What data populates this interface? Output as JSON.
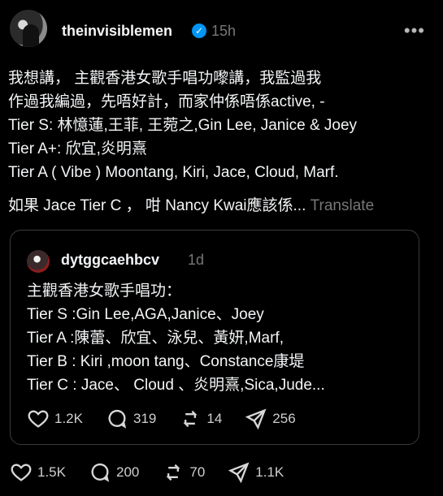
{
  "author": {
    "username": "theinvisiblemen",
    "time": "15h",
    "verified_mark": "✓",
    "more": "•••"
  },
  "post": {
    "lines": [
      "我想講， 主觀香港女歌手唱功嚟講，我監過我",
      "作過我編過，先唔好計，而家仲係唔係active, -",
      "Tier S: 林憶蓮,王菲, 王菀之,Gin Lee, Janice & Joey",
      "Tier A+: 欣宜,炎明熹",
      "Tier A ( Vibe ) Moontang, Kiri, Jace, Cloud, Marf."
    ],
    "trailing_text": "如果 Jace Tier C ， 咁 Nancy Kwai應該係...",
    "translate_label": "Translate"
  },
  "quote": {
    "username": "dytggcaehbcv",
    "time": "1d",
    "lines": [
      "主觀香港女歌手唱功：",
      "Tier S :Gin Lee,AGA,Janice、Joey",
      "Tier A :陳蕾、欣宜、泳兒、黃妍,Marf,",
      "Tier B : Kiri ,moon tang、Constance康堤",
      "Tier C : Jace、 Cloud 、炎明熹,Sica,Jude..."
    ],
    "actions": {
      "likes": "1.2K",
      "comments": "319",
      "reposts": "14",
      "shares": "256"
    }
  },
  "actions": {
    "likes": "1.5K",
    "comments": "200",
    "reposts": "70",
    "shares": "1.1K"
  },
  "icons": [
    "heart-icon",
    "comment-icon",
    "repost-icon",
    "share-icon"
  ]
}
